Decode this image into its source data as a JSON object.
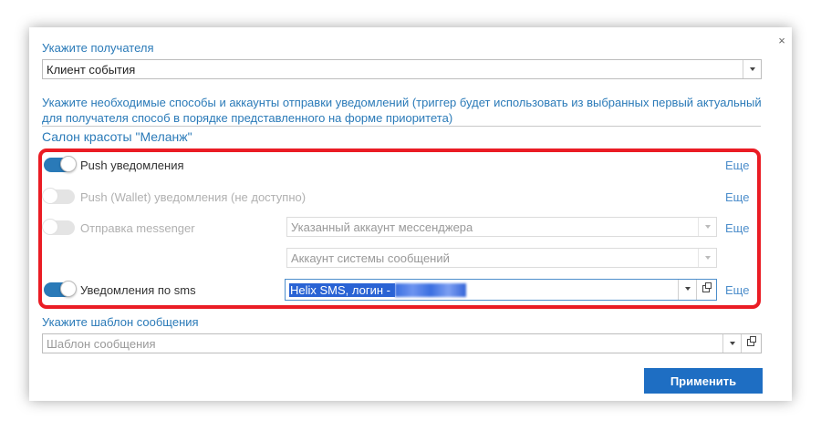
{
  "dialog": {
    "close_glyph": "×",
    "recipient": {
      "label": "Укажите получателя",
      "value": "Клиент события"
    },
    "description": "Укажите необходимые способы и аккаунты отправки уведомлений (триггер будет использовать из выбранных первый актуальный для получателя способ в порядке представленного на форме приоритета)",
    "section_title": "Салон красоты \"Меланж\"",
    "rows": [
      {
        "label": "Push уведомления",
        "enabled": true,
        "more": "Еще"
      },
      {
        "label": "Push (Wallet) уведомления (не доступно)",
        "enabled": false,
        "more": "Еще"
      },
      {
        "label": "Отправка messenger",
        "enabled": false,
        "more": "Еще",
        "select_primary": "Указанный аккаунт мессенджера",
        "select_secondary": "Аккаунт системы сообщений"
      },
      {
        "label": "Уведомления по sms",
        "enabled": true,
        "more": "Еще",
        "select_value": "Helix SMS, логин - "
      }
    ],
    "template": {
      "label": "Укажите шаблон сообщения",
      "placeholder": "Шаблон сообщения"
    },
    "apply_label": "Применить",
    "colors": {
      "accent": "#2a7ab8",
      "highlight": "#ea1c24",
      "button": "#1e6ec3",
      "link": "#4d8ecb"
    }
  }
}
